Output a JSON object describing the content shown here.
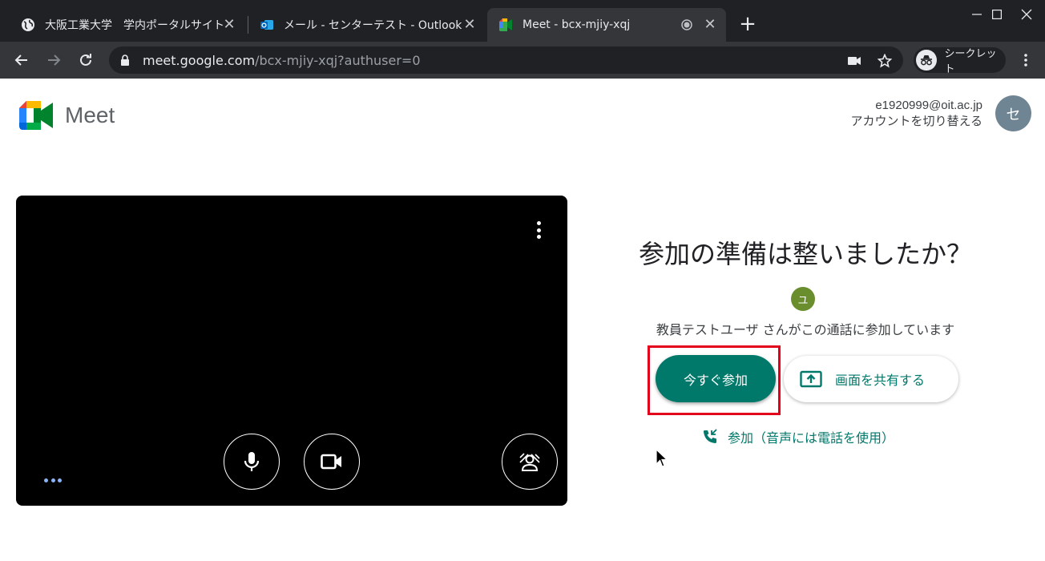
{
  "browser": {
    "tabs": [
      {
        "title": "大阪工業大学　学内ポータルサイト",
        "close": "✕"
      },
      {
        "title": "メール - センターテスト - Outlook",
        "close": "✕"
      },
      {
        "title": "Meet - bcx-mjiy-xqj",
        "close": "✕"
      }
    ],
    "url_host": "meet.google.com",
    "url_path": "/bcx-mjiy-xqj?authuser=0",
    "incognito_label": "シークレット",
    "new_tab": "+"
  },
  "meet": {
    "brand": "Meet",
    "account_email": "e1920999@oit.ac.jp",
    "switch_account": "アカウントを切り替える",
    "avatar_initial": "セ",
    "heading": "参加の準備は整いましたか？",
    "participant_initial": "ユ",
    "joining_text": "教員テストユーザ さんがこの通話に参加しています",
    "join_now": "今すぐ参加",
    "present": "画面を共有する",
    "join_by_phone": "参加（音声には電話を使用）"
  },
  "colors": {
    "accent": "#00796b",
    "highlight_box": "#e3001b",
    "chrome_dark": "#202124",
    "chrome_toolbar": "#35363a"
  },
  "icons": [
    "globe-icon",
    "outlook-icon",
    "meet-icon",
    "record-icon",
    "lock-icon",
    "camera-blocked-icon",
    "star-icon",
    "incognito-icon",
    "more-vert-icon",
    "mic-icon",
    "videocam-icon",
    "background-blur-icon",
    "present-icon",
    "phone-icon"
  ]
}
